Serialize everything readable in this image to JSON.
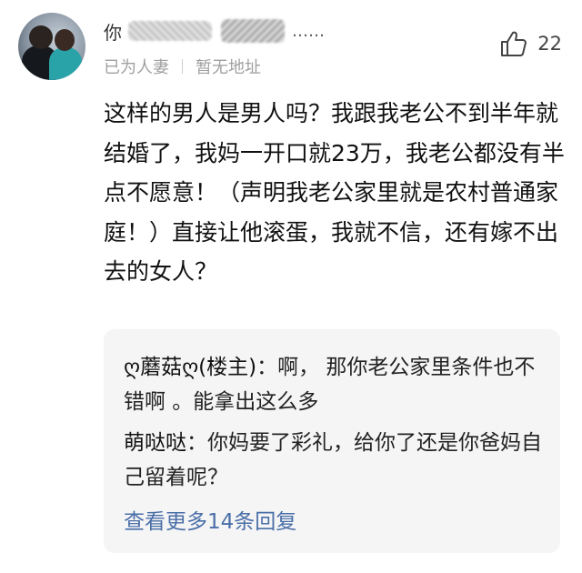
{
  "comment": {
    "username": "你",
    "username_suffix": "……",
    "status": "已为人妻",
    "location": "暂无地址",
    "likes": "22",
    "content": "这样的男人是男人吗？我跟我老公不到半年就结婚了，我妈一开口就23万，我老公都没有半点不愿意！（声明我老公家里就是农村普通家庭！）直接让他滚蛋，我就不信，还有嫁不出去的女人？"
  },
  "replies": [
    {
      "author": "ღ蘑菇ღ(楼主)",
      "separator": "：",
      "text": "啊， 那你老公家里条件也不错啊 。能拿出这么多"
    },
    {
      "author": "萌哒哒",
      "separator": "：",
      "text": "你妈要了彩礼，给你了还是你爸妈自己留着呢？"
    }
  ],
  "more_replies_label": "查看更多14条回复",
  "icons": {
    "like": "thumbs-up-icon"
  },
  "colors": {
    "link": "#4a6fa8",
    "meta": "#a0a0a0",
    "reply_bg": "#f5f5f5"
  }
}
